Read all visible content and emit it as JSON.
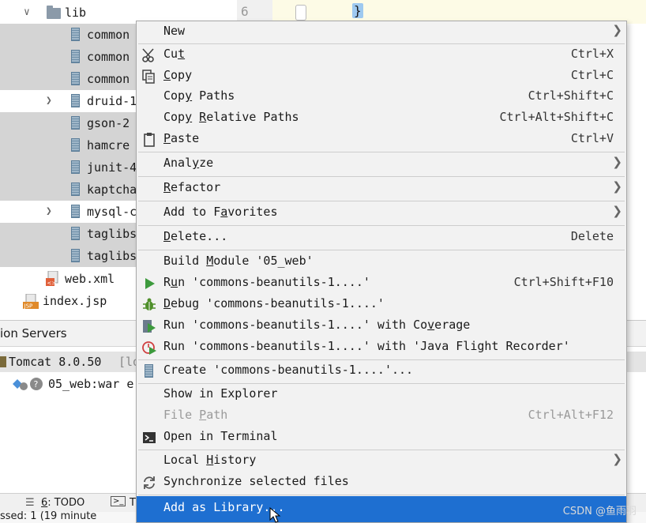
{
  "editor": {
    "line_number": "6",
    "brace": "}"
  },
  "tree": {
    "folder": "lib",
    "items": [
      "common",
      "common",
      "common",
      "druid-1",
      "gson-2",
      "hamcre",
      "junit-4",
      "kaptcha",
      "mysql-c",
      "taglibs",
      "taglibs"
    ],
    "web_xml": "web.xml",
    "index_jsp": "index.jsp"
  },
  "services": {
    "title": "ion Servers",
    "tomcat": "Tomcat 8.0.50",
    "tomcat_suffix": "[lo",
    "artifact": "05_web:war e"
  },
  "statusbar": {
    "todo_num": "6",
    "todo_label": ": TODO",
    "next": "T",
    "bottom_text": "ssed: 1 (19 minute"
  },
  "menu": {
    "new": "New",
    "cut": [
      "Cu",
      "t"
    ],
    "cut_sc": "Ctrl+X",
    "copy": [
      "",
      "C",
      "opy"
    ],
    "copy_sc": "Ctrl+C",
    "copy_paths": [
      "Cop",
      "y",
      " Paths"
    ],
    "copy_paths_sc": "Ctrl+Shift+C",
    "copy_rel": [
      "Cop",
      "y",
      " ",
      "R",
      "elative Paths"
    ],
    "copy_rel_sc": "Ctrl+Alt+Shift+C",
    "paste": [
      "",
      "P",
      "aste"
    ],
    "paste_sc": "Ctrl+V",
    "analyze": [
      "Anal",
      "y",
      "ze"
    ],
    "refactor": [
      "",
      "R",
      "efactor"
    ],
    "favorites": [
      "Add to F",
      "a",
      "vorites"
    ],
    "delete": [
      "",
      "D",
      "elete..."
    ],
    "delete_sc": "Delete",
    "build": [
      "Build ",
      "M",
      "odule '05_web'"
    ],
    "run": [
      "R",
      "u",
      "n 'commons-beanutils-1....'"
    ],
    "run_sc": "Ctrl+Shift+F10",
    "debug": [
      "",
      "D",
      "ebug 'commons-beanutils-1....'"
    ],
    "coverage": [
      "Run 'commons-beanutils-1....' with Co",
      "v",
      "erage"
    ],
    "jfr": "Run 'commons-beanutils-1....' with 'Java Flight Recorder'",
    "create": "Create 'commons-beanutils-1....'...",
    "show_explorer": "Show in Explorer",
    "file_path": [
      "File ",
      "P",
      "ath"
    ],
    "file_path_sc": "Ctrl+Alt+F12",
    "terminal": "Open in Terminal",
    "local_history": [
      "Local ",
      "H",
      "istory"
    ],
    "sync": "Synchronize selected files",
    "add_library": "Add as Library..."
  },
  "watermark": "CSDN @鱼雨羽",
  "colors": {
    "highlight": "#1e6fd1",
    "run": "#3d9a3d",
    "debug": "#4f8f2a",
    "selected_row": "#d4d4d4"
  }
}
